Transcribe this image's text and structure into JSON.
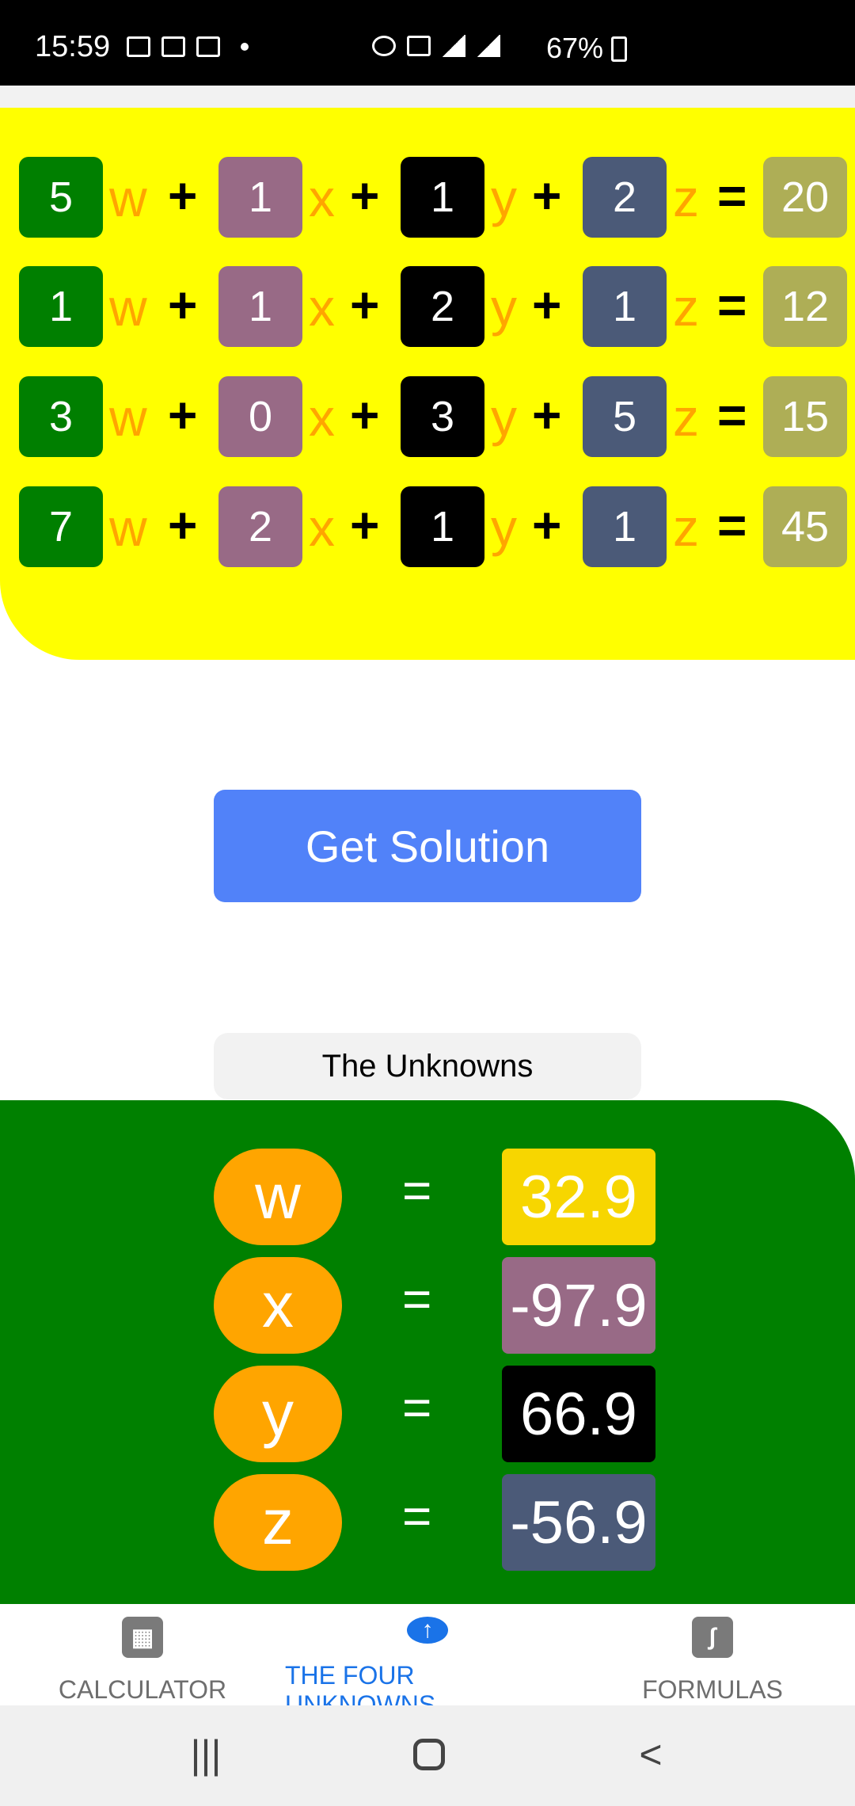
{
  "status_bar": {
    "time": "15:59",
    "battery": "67%",
    "network": "4G"
  },
  "equations": [
    {
      "coeffs": [
        "5",
        "1",
        "1",
        "2"
      ],
      "result": "20"
    },
    {
      "coeffs": [
        "1",
        "1",
        "2",
        "1"
      ],
      "result": "12"
    },
    {
      "coeffs": [
        "3",
        "0",
        "3",
        "5"
      ],
      "result": "15"
    },
    {
      "coeffs": [
        "7",
        "2",
        "1",
        "1"
      ],
      "result": "45"
    }
  ],
  "variables": [
    "w",
    "x",
    "y",
    "z"
  ],
  "operators": {
    "plus": "+",
    "equals": "="
  },
  "solve_button": {
    "label": "Get Solution"
  },
  "unknowns_header": "The Unknowns",
  "solutions": [
    {
      "var": "w",
      "value": "32.9"
    },
    {
      "var": "x",
      "value": "-97.9"
    },
    {
      "var": "y",
      "value": "66.9"
    },
    {
      "var": "z",
      "value": "-56.9"
    }
  ],
  "nav": {
    "items": [
      {
        "label": "CALCULATOR",
        "icon": "calculator-icon"
      },
      {
        "label": "THE FOUR UNKNOWNS",
        "icon": "brain-icon"
      },
      {
        "label": "FORMULAS",
        "icon": "formula-icon"
      }
    ],
    "active": "THE FOUR UNKNOWNS"
  },
  "colors": {
    "equation_panel": "#ffff00",
    "result_panel": "#008000",
    "variable": "#ffa500",
    "button": "#5182f9",
    "active_nav": "#1a73e8"
  }
}
